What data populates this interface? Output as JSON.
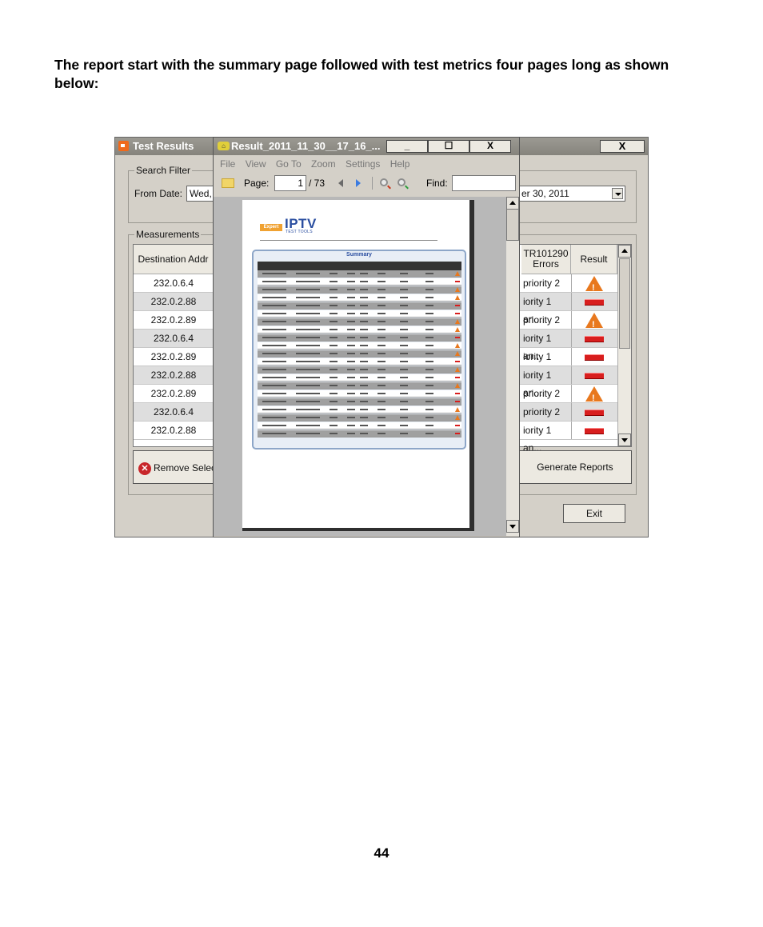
{
  "heading": "The report start with the summary page followed with test metrics four pages long as shown below:",
  "page_number": "44",
  "test_results_window": {
    "title": "Test Results",
    "close_glyph": "X",
    "search_filter_label": "Search Filter",
    "from_date_label": "From Date:",
    "from_date_value": "Wed,",
    "to_date_value": "er 30, 2011",
    "measurements_label": "Measurements",
    "columns": {
      "destination": "Destination Addr",
      "errors_line1": "TR101290",
      "errors_line2": "Errors",
      "result": "Result"
    },
    "rows": [
      {
        "dest": "232.0.6.4",
        "errors": "priority 2",
        "result": "warning-icon"
      },
      {
        "dest": "232.0.2.88",
        "errors": "iority 1 an...",
        "result": "fail-icon"
      },
      {
        "dest": "232.0.2.89",
        "errors": "priority 2",
        "result": "warning-icon"
      },
      {
        "dest": "232.0.6.4",
        "errors": "iority 1 an...",
        "result": "fail-icon"
      },
      {
        "dest": "232.0.2.89",
        "errors": "iority 1 an...",
        "result": "fail-icon"
      },
      {
        "dest": "232.0.2.88",
        "errors": "iority 1 an...",
        "result": "fail-icon"
      },
      {
        "dest": "232.0.2.89",
        "errors": "priority 2",
        "result": "warning-icon"
      },
      {
        "dest": "232.0.6.4",
        "errors": "priority 2",
        "result": "fail-icon"
      },
      {
        "dest": "232.0.2.88",
        "errors": "iority 1 an...",
        "result": "fail-icon"
      }
    ],
    "remove_button": "Remove Selec",
    "generate_button": "Generate Reports",
    "exit_button": "Exit"
  },
  "pdf_window": {
    "title": "Result_2011_11_30__17_16_...",
    "minimize_glyph": "_",
    "maximize_glyph": "☐",
    "close_glyph": "X",
    "menu": [
      "File",
      "View",
      "Go To",
      "Zoom",
      "Settings",
      "Help"
    ],
    "page_label": "Page:",
    "page_current": "1",
    "page_total": "/ 73",
    "find_label": "Find:",
    "find_value": "",
    "doc": {
      "logo_badge": "Expert",
      "logo_main": "IPTV",
      "logo_sub": "TEST TOOLS",
      "summary_title": "Summary"
    }
  },
  "colors": {
    "warning": "#e8781e",
    "fail": "#d81e1e",
    "logo_blue": "#2a4ea0",
    "logo_orange": "#f0a232"
  }
}
